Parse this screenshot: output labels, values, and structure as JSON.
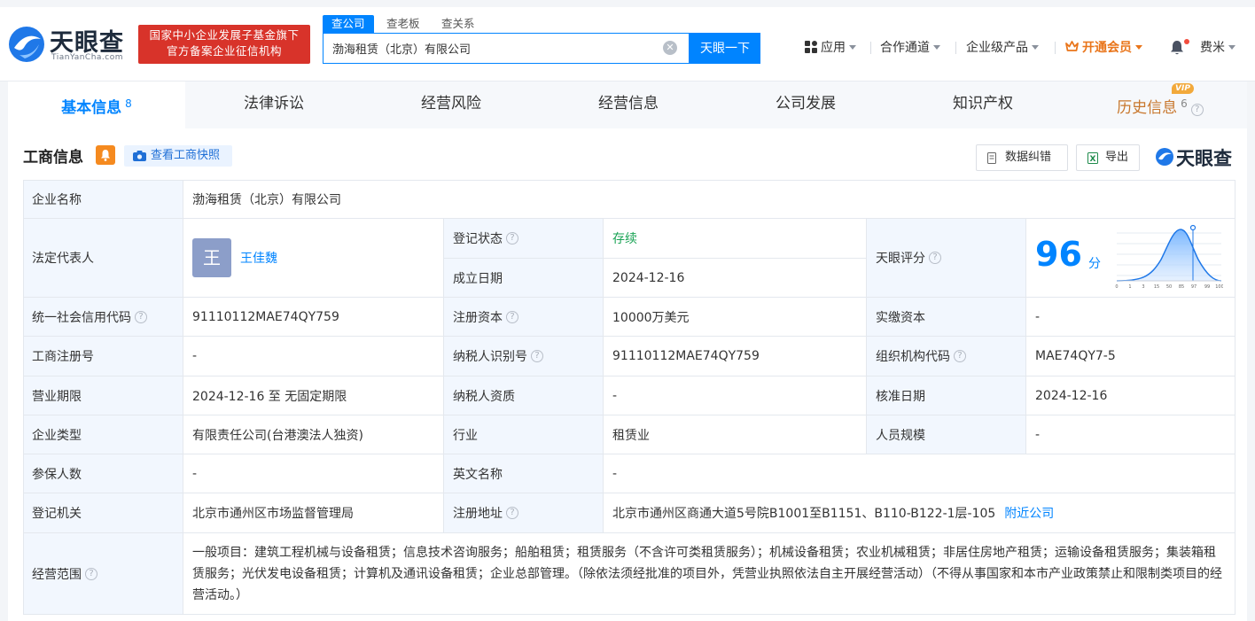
{
  "header": {
    "logo_name": "天眼查",
    "logo_url": "TianYanCha.com",
    "banner_line1": "国家中小企业发展子基金旗下",
    "banner_line2": "官方备案企业征信机构",
    "search_tabs": [
      "查公司",
      "查老板",
      "查关系"
    ],
    "search_value": "渤海租赁（北京）有限公司",
    "search_button": "天眼一下",
    "nav": {
      "apps": "应用",
      "channels": "合作通道",
      "enterprise": "企业级产品",
      "vip": "开通会员",
      "user": "费米"
    },
    "icons": [
      "apps-icon",
      "crown-icon",
      "bell-icon",
      "clear-icon"
    ]
  },
  "tabs": [
    {
      "label": "基本信息",
      "count": "8"
    },
    {
      "label": "法律诉讼"
    },
    {
      "label": "经营风险"
    },
    {
      "label": "经营信息"
    },
    {
      "label": "公司发展"
    },
    {
      "label": "知识产权"
    },
    {
      "label": "历史信息",
      "count": "6",
      "badge": "VIP"
    }
  ],
  "section": {
    "title": "工商信息",
    "snapshot_button": "查看工商快照",
    "correct_button": "数据纠错",
    "export_button": "导出",
    "logo_name": "天眼查"
  },
  "info": {
    "company_name_label": "企业名称",
    "company_name": "渤海租赁（北京）有限公司",
    "legal_rep_label": "法定代表人",
    "legal_rep_avatar": "王",
    "legal_rep": "王佳魏",
    "reg_status_label": "登记状态",
    "reg_status": "存续",
    "est_date_label": "成立日期",
    "est_date": "2024-12-16",
    "score_label": "天眼评分",
    "score": "96",
    "score_unit": "分",
    "score_axis": [
      "0",
      "1",
      "3",
      "15",
      "50",
      "85",
      "97",
      "99",
      "100"
    ],
    "credit_code_label": "统一社会信用代码",
    "credit_code": "91110112MAE74QY759",
    "reg_capital_label": "注册资本",
    "reg_capital": "10000万美元",
    "paid_capital_label": "实缴资本",
    "paid_capital": "-",
    "reg_no_label": "工商注册号",
    "reg_no": "-",
    "taxpayer_id_label": "纳税人识别号",
    "taxpayer_id": "91110112MAE74QY759",
    "org_code_label": "组织机构代码",
    "org_code": "MAE74QY7-5",
    "term_label": "营业期限",
    "term": "2024-12-16 至 无固定期限",
    "taxpayer_qual_label": "纳税人资质",
    "taxpayer_qual": "-",
    "approve_date_label": "核准日期",
    "approve_date": "2024-12-16",
    "type_label": "企业类型",
    "type": "有限责任公司(台港澳法人独资)",
    "industry_label": "行业",
    "industry": "租赁业",
    "staff_label": "人员规模",
    "staff": "-",
    "insured_label": "参保人数",
    "insured": "-",
    "en_name_label": "英文名称",
    "en_name": "-",
    "authority_label": "登记机关",
    "authority": "北京市通州区市场监督管理局",
    "address_label": "注册地址",
    "address": "北京市通州区商通大道5号院B1001至B1151、B110-B122-1层-105",
    "nearby_link": "附近公司",
    "scope_label": "经营范围",
    "scope": "一般项目：建筑工程机械与设备租赁；信息技术咨询服务；船舶租赁；租赁服务（不含许可类租赁服务）；机械设备租赁；农业机械租赁；非居住房地产租赁；运输设备租赁服务；集装箱租赁服务；光伏发电设备租赁；计算机及通讯设备租赁；企业总部管理。（除依法须经批准的项目外，凭营业执照依法自主开展经营活动）（不得从事国家和本市产业政策禁止和限制类项目的经营活动。）"
  },
  "colors": {
    "accent": "#0084ff",
    "brand_red": "#d8332a",
    "status_green": "#1aa355",
    "vip_orange": "#e9751a"
  }
}
